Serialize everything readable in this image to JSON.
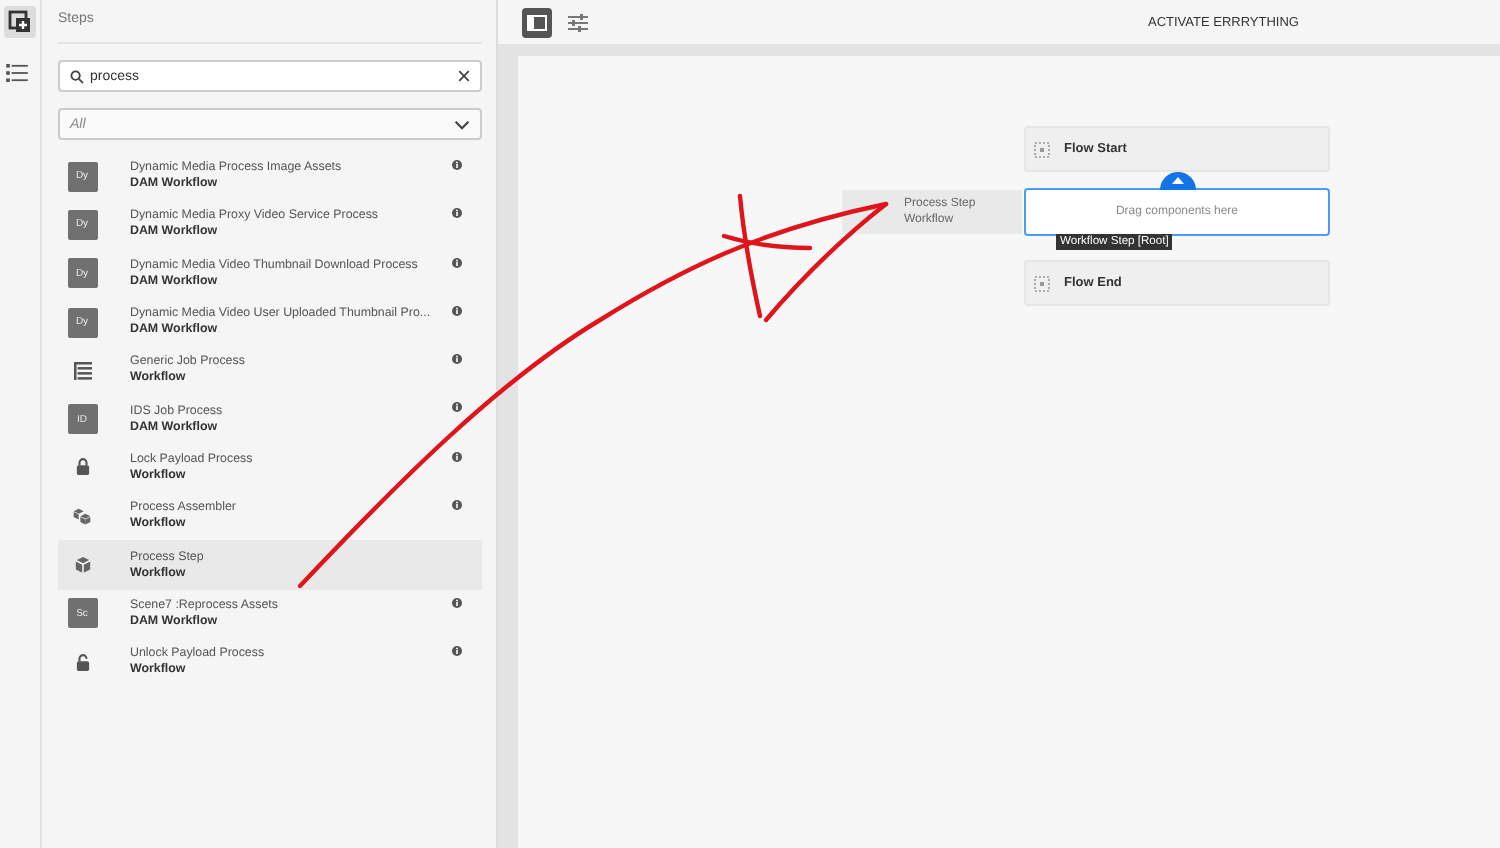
{
  "sidebar": {
    "title": "Steps",
    "search": {
      "value": "process"
    },
    "filter": {
      "value": "All"
    },
    "items": [
      {
        "kind": "badge",
        "badge": "Dy",
        "title": "Dynamic Media Process Image Assets",
        "subtitle": "DAM Workflow",
        "selected": false,
        "info": true
      },
      {
        "kind": "badge",
        "badge": "Dy",
        "title": "Dynamic Media Proxy Video Service Process",
        "subtitle": "DAM Workflow",
        "selected": false,
        "info": true
      },
      {
        "kind": "badge",
        "badge": "Dy",
        "title": "Dynamic Media Video Thumbnail Download Process",
        "subtitle": "DAM Workflow",
        "selected": false,
        "info": true
      },
      {
        "kind": "badge",
        "badge": "Dy",
        "title": "Dynamic Media Video User Uploaded Thumbnail Pro...",
        "subtitle": "DAM Workflow",
        "selected": false,
        "info": true
      },
      {
        "kind": "list",
        "title": "Generic Job Process",
        "subtitle": "Workflow",
        "selected": false,
        "info": true
      },
      {
        "kind": "badge",
        "badge": "ID",
        "title": "IDS Job Process",
        "subtitle": "DAM Workflow",
        "selected": false,
        "info": true
      },
      {
        "kind": "lock",
        "title": "Lock Payload Process",
        "subtitle": "Workflow",
        "selected": false,
        "info": true
      },
      {
        "kind": "boxes",
        "title": "Process Assembler",
        "subtitle": "Workflow",
        "selected": false,
        "info": true
      },
      {
        "kind": "cube",
        "title": "Process Step",
        "subtitle": "Workflow",
        "selected": true,
        "info": false
      },
      {
        "kind": "badge",
        "badge": "Sc",
        "title": "Scene7 :Reprocess Assets",
        "subtitle": "DAM Workflow",
        "selected": false,
        "info": true
      },
      {
        "kind": "unlock",
        "title": "Unlock Payload Process",
        "subtitle": "Workflow",
        "selected": false,
        "info": true
      }
    ]
  },
  "title": "ACTIVATE ERRRYTHING",
  "canvas": {
    "start": "Flow Start",
    "dropzone": {
      "placeholder": "Drag components here"
    },
    "tooltip": "Workflow Step [Root]",
    "end": "Flow End",
    "dragged": {
      "title": "Process Step",
      "subtitle": "Workflow"
    }
  }
}
